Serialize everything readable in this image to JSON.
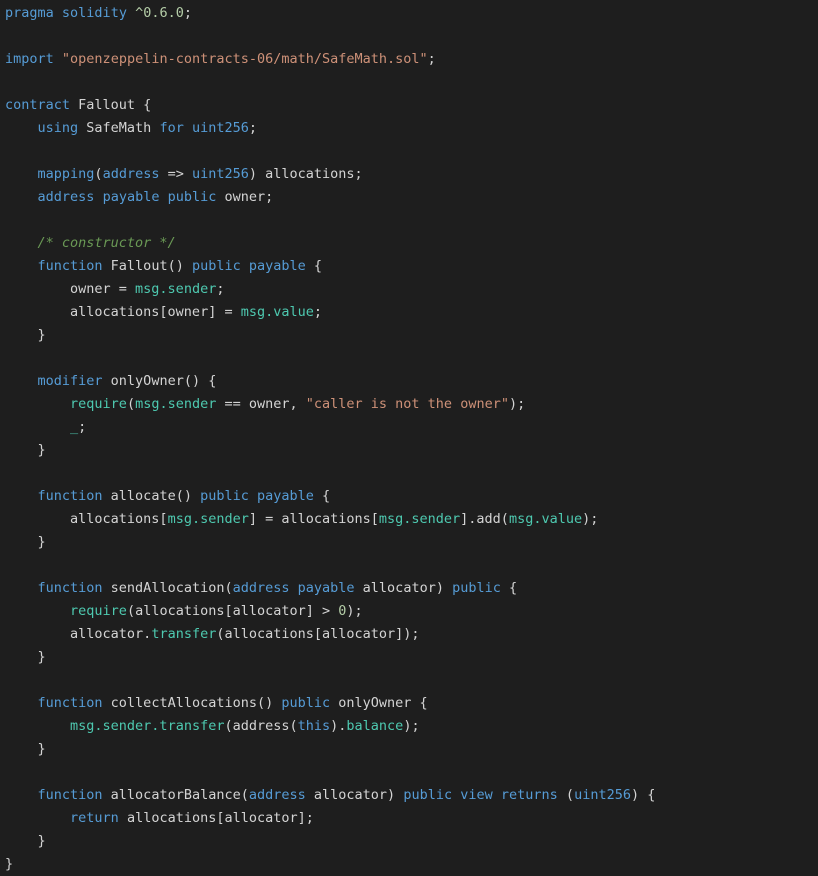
{
  "editor": {
    "language": "solidity",
    "colors": {
      "background": "#1e1e1e",
      "text": "#d4d4d4",
      "keyword": "#569cd6",
      "string": "#ce9178",
      "comment": "#6a9955",
      "number": "#b5cea8",
      "member": "#4ec9b0"
    },
    "lines": [
      [
        [
          "kw",
          "pragma"
        ],
        [
          "plain",
          " "
        ],
        [
          "kw",
          "solidity"
        ],
        [
          "plain",
          " "
        ],
        [
          "num",
          "^0.6.0"
        ],
        [
          "plain",
          ";"
        ]
      ],
      [],
      [
        [
          "kw",
          "import"
        ],
        [
          "plain",
          " "
        ],
        [
          "str",
          "\"openzeppelin-contracts-06/math/SafeMath.sol\""
        ],
        [
          "plain",
          ";"
        ]
      ],
      [],
      [
        [
          "kw",
          "contract"
        ],
        [
          "plain",
          " Fallout {"
        ]
      ],
      [
        [
          "plain",
          "    "
        ],
        [
          "kw",
          "using"
        ],
        [
          "plain",
          " SafeMath "
        ],
        [
          "kw",
          "for"
        ],
        [
          "plain",
          " "
        ],
        [
          "kw",
          "uint256"
        ],
        [
          "plain",
          ";"
        ]
      ],
      [],
      [
        [
          "plain",
          "    "
        ],
        [
          "kw",
          "mapping"
        ],
        [
          "plain",
          "("
        ],
        [
          "kw",
          "address"
        ],
        [
          "plain",
          " => "
        ],
        [
          "kw",
          "uint256"
        ],
        [
          "plain",
          ") allocations;"
        ]
      ],
      [
        [
          "plain",
          "    "
        ],
        [
          "kw",
          "address"
        ],
        [
          "plain",
          " "
        ],
        [
          "kw",
          "payable"
        ],
        [
          "plain",
          " "
        ],
        [
          "kw",
          "public"
        ],
        [
          "plain",
          " owner;"
        ]
      ],
      [],
      [
        [
          "plain",
          "    "
        ],
        [
          "cmt",
          "/* constructor */"
        ]
      ],
      [
        [
          "plain",
          "    "
        ],
        [
          "kw",
          "function"
        ],
        [
          "plain",
          " Fallout() "
        ],
        [
          "kw",
          "public"
        ],
        [
          "plain",
          " "
        ],
        [
          "kw",
          "payable"
        ],
        [
          "plain",
          " {"
        ]
      ],
      [
        [
          "plain",
          "        owner = "
        ],
        [
          "mem",
          "msg.sender"
        ],
        [
          "plain",
          ";"
        ]
      ],
      [
        [
          "plain",
          "        allocations[owner] = "
        ],
        [
          "mem",
          "msg.value"
        ],
        [
          "plain",
          ";"
        ]
      ],
      [
        [
          "plain",
          "    }"
        ]
      ],
      [],
      [
        [
          "plain",
          "    "
        ],
        [
          "kw",
          "modifier"
        ],
        [
          "plain",
          " onlyOwner() {"
        ]
      ],
      [
        [
          "plain",
          "        "
        ],
        [
          "req",
          "require"
        ],
        [
          "plain",
          "("
        ],
        [
          "mem",
          "msg.sender"
        ],
        [
          "plain",
          " == owner, "
        ],
        [
          "str",
          "\"caller is not the owner\""
        ],
        [
          "plain",
          ");"
        ]
      ],
      [
        [
          "plain",
          "        "
        ],
        [
          "mem",
          "_"
        ],
        [
          "plain",
          ";"
        ]
      ],
      [
        [
          "plain",
          "    }"
        ]
      ],
      [],
      [
        [
          "plain",
          "    "
        ],
        [
          "kw",
          "function"
        ],
        [
          "plain",
          " allocate() "
        ],
        [
          "kw",
          "public"
        ],
        [
          "plain",
          " "
        ],
        [
          "kw",
          "payable"
        ],
        [
          "plain",
          " {"
        ]
      ],
      [
        [
          "plain",
          "        allocations["
        ],
        [
          "mem",
          "msg.sender"
        ],
        [
          "plain",
          "] = allocations["
        ],
        [
          "mem",
          "msg.sender"
        ],
        [
          "plain",
          "].add("
        ],
        [
          "mem",
          "msg.value"
        ],
        [
          "plain",
          ");"
        ]
      ],
      [
        [
          "plain",
          "    }"
        ]
      ],
      [],
      [
        [
          "plain",
          "    "
        ],
        [
          "kw",
          "function"
        ],
        [
          "plain",
          " sendAllocation("
        ],
        [
          "kw",
          "address"
        ],
        [
          "plain",
          " "
        ],
        [
          "kw",
          "payable"
        ],
        [
          "plain",
          " allocator) "
        ],
        [
          "kw",
          "public"
        ],
        [
          "plain",
          " {"
        ]
      ],
      [
        [
          "plain",
          "        "
        ],
        [
          "req",
          "require"
        ],
        [
          "plain",
          "(allocations[allocator] > "
        ],
        [
          "num",
          "0"
        ],
        [
          "plain",
          ");"
        ]
      ],
      [
        [
          "plain",
          "        allocator."
        ],
        [
          "mem",
          "transfer"
        ],
        [
          "plain",
          "(allocations[allocator]);"
        ]
      ],
      [
        [
          "plain",
          "    }"
        ]
      ],
      [],
      [
        [
          "plain",
          "    "
        ],
        [
          "kw",
          "function"
        ],
        [
          "plain",
          " collectAllocations() "
        ],
        [
          "kw",
          "public"
        ],
        [
          "plain",
          " onlyOwner {"
        ]
      ],
      [
        [
          "plain",
          "        "
        ],
        [
          "mem",
          "msg.sender.transfer"
        ],
        [
          "plain",
          "(address("
        ],
        [
          "kw",
          "this"
        ],
        [
          "plain",
          ")."
        ],
        [
          "mem",
          "balance"
        ],
        [
          "plain",
          ");"
        ]
      ],
      [
        [
          "plain",
          "    }"
        ]
      ],
      [],
      [
        [
          "plain",
          "    "
        ],
        [
          "kw",
          "function"
        ],
        [
          "plain",
          " allocatorBalance("
        ],
        [
          "kw",
          "address"
        ],
        [
          "plain",
          " allocator) "
        ],
        [
          "kw",
          "public"
        ],
        [
          "plain",
          " "
        ],
        [
          "kw",
          "view"
        ],
        [
          "plain",
          " "
        ],
        [
          "kw",
          "returns"
        ],
        [
          "plain",
          " ("
        ],
        [
          "kw",
          "uint256"
        ],
        [
          "plain",
          ") {"
        ]
      ],
      [
        [
          "plain",
          "        "
        ],
        [
          "kw",
          "return"
        ],
        [
          "plain",
          " allocations[allocator];"
        ]
      ],
      [
        [
          "plain",
          "    }"
        ]
      ],
      [
        [
          "plain",
          "}"
        ]
      ]
    ]
  }
}
